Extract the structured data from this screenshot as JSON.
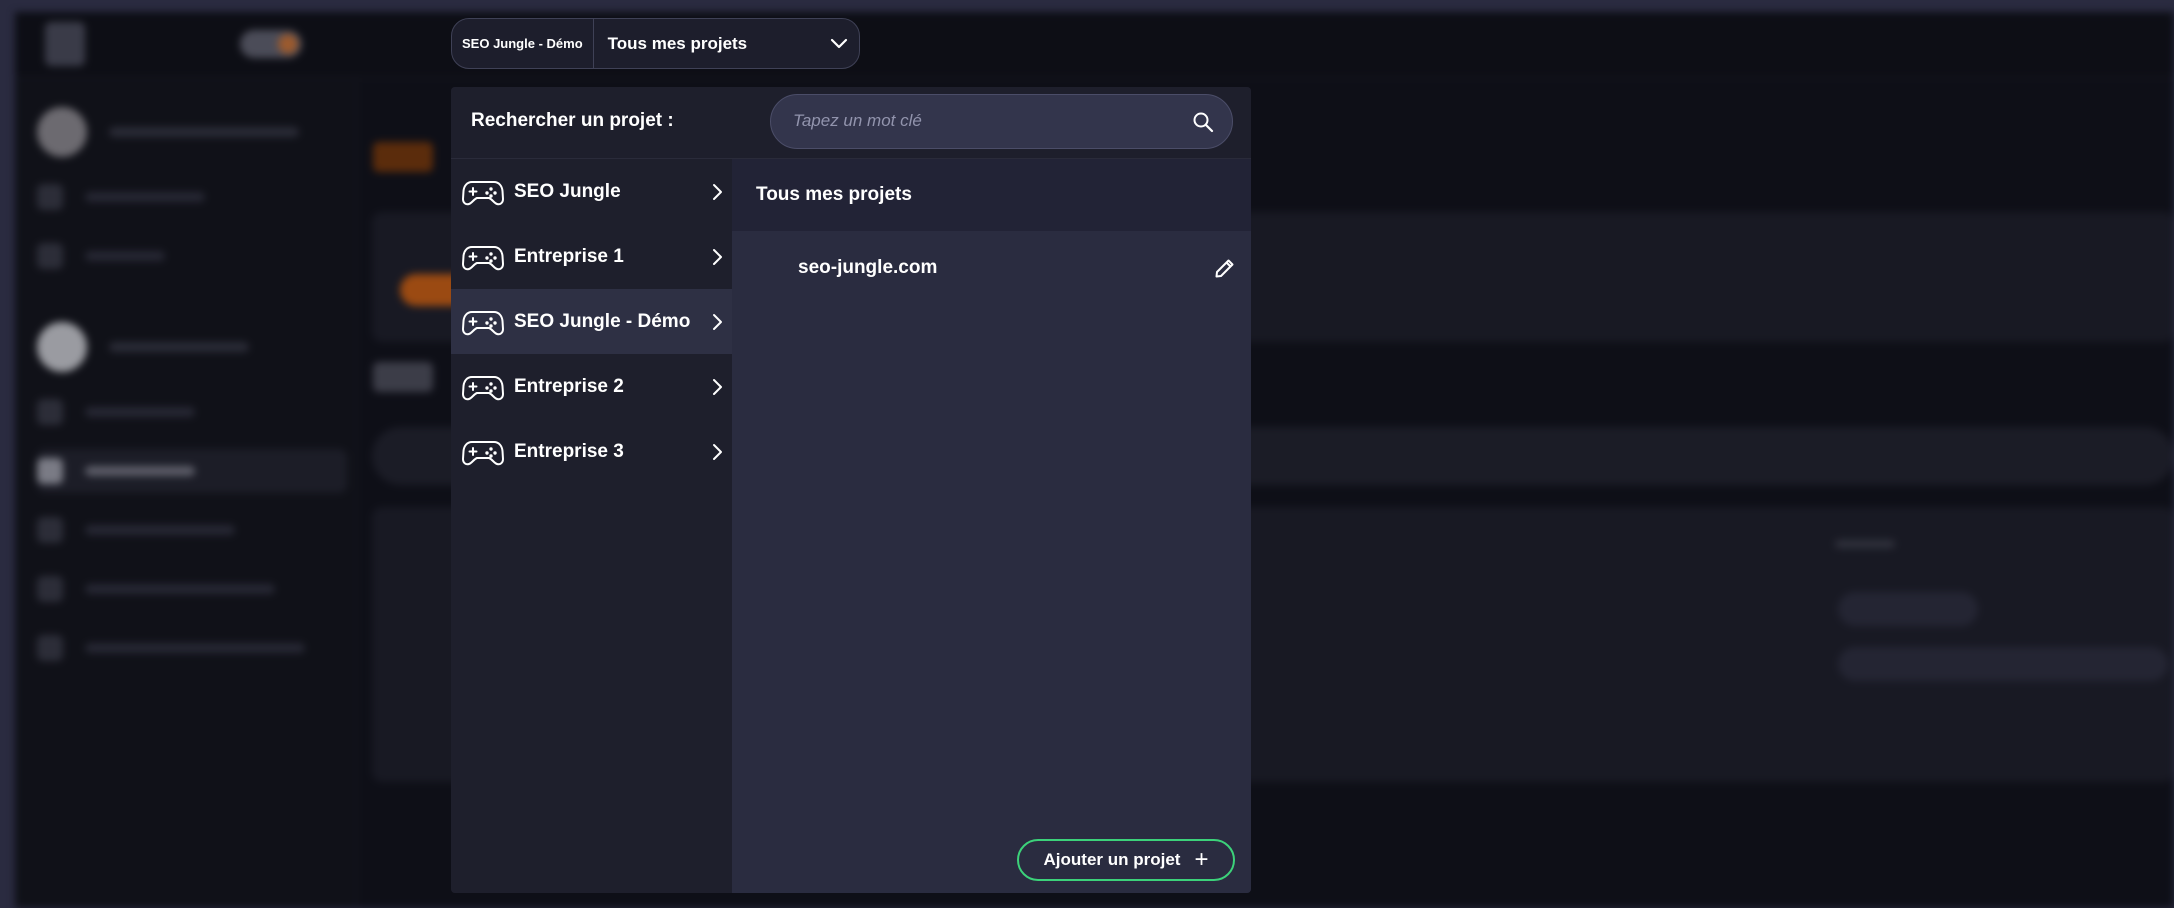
{
  "selector": {
    "current_org": "SEO Jungle - Démo",
    "current_project": "Tous mes projets"
  },
  "search": {
    "label": "Rechercher un projet :",
    "placeholder": "Tapez un mot clé"
  },
  "organizations": [
    {
      "name": "SEO Jungle",
      "icon": "gamepad-icon",
      "active": false
    },
    {
      "name": "Entreprise 1",
      "icon": "gamepad-icon",
      "active": false
    },
    {
      "name": "SEO Jungle - Démo",
      "icon": "gamepad-icon",
      "active": true
    },
    {
      "name": "Entreprise 2",
      "icon": "gamepad-icon",
      "active": false
    },
    {
      "name": "Entreprise 3",
      "icon": "gamepad-icon",
      "active": false
    }
  ],
  "projects_pane": {
    "header": "Tous mes projets",
    "projects": [
      {
        "name": "seo-jungle.com"
      }
    ],
    "add_button_label": "Ajouter un projet"
  },
  "colors": {
    "accent_green": "#3cd27a",
    "panel_bg": "#1e1f2c",
    "active_item_bg": "#2e3044",
    "search_bg": "#33354c"
  }
}
